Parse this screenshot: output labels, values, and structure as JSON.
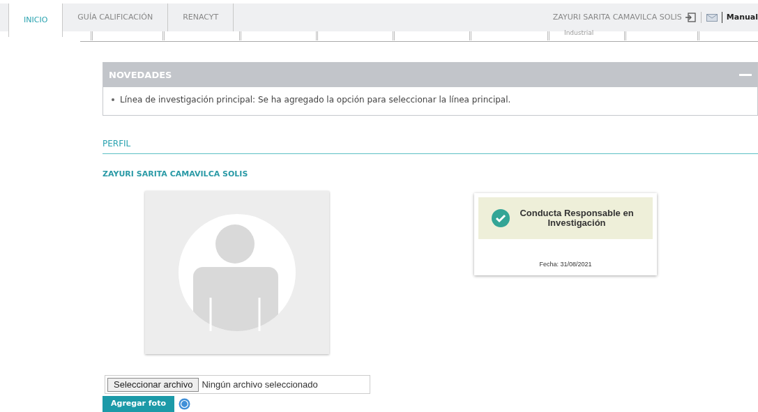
{
  "tabs": [
    {
      "label": "INICIO",
      "selected": true
    },
    {
      "label": "GUÍA CALIFICACIÓN",
      "selected": false
    },
    {
      "label": "RENACYT",
      "selected": false
    }
  ],
  "user": {
    "name": "ZAYURI SARITA CAMAVILCA SOLIS",
    "manual": "Manual"
  },
  "submenu": {
    "partial_label": "Industrial"
  },
  "novedades": {
    "title": "NOVEDADES",
    "expanded": true,
    "items": [
      "Línea de investigación principal: Se ha agregado la opción para seleccionar la línea principal."
    ]
  },
  "perfil": {
    "title": "PERFIL",
    "name": "ZAYURI SARITA CAMAVILCA SOLIS"
  },
  "certificate": {
    "title": "Conducta Responsable en Investigación",
    "date": "Fecha: 31/08/2021"
  },
  "file_input": {
    "button": "Seleccionar archivo",
    "status": "Ningún archivo seleccionado"
  },
  "add_photo": "Agregar foto"
}
